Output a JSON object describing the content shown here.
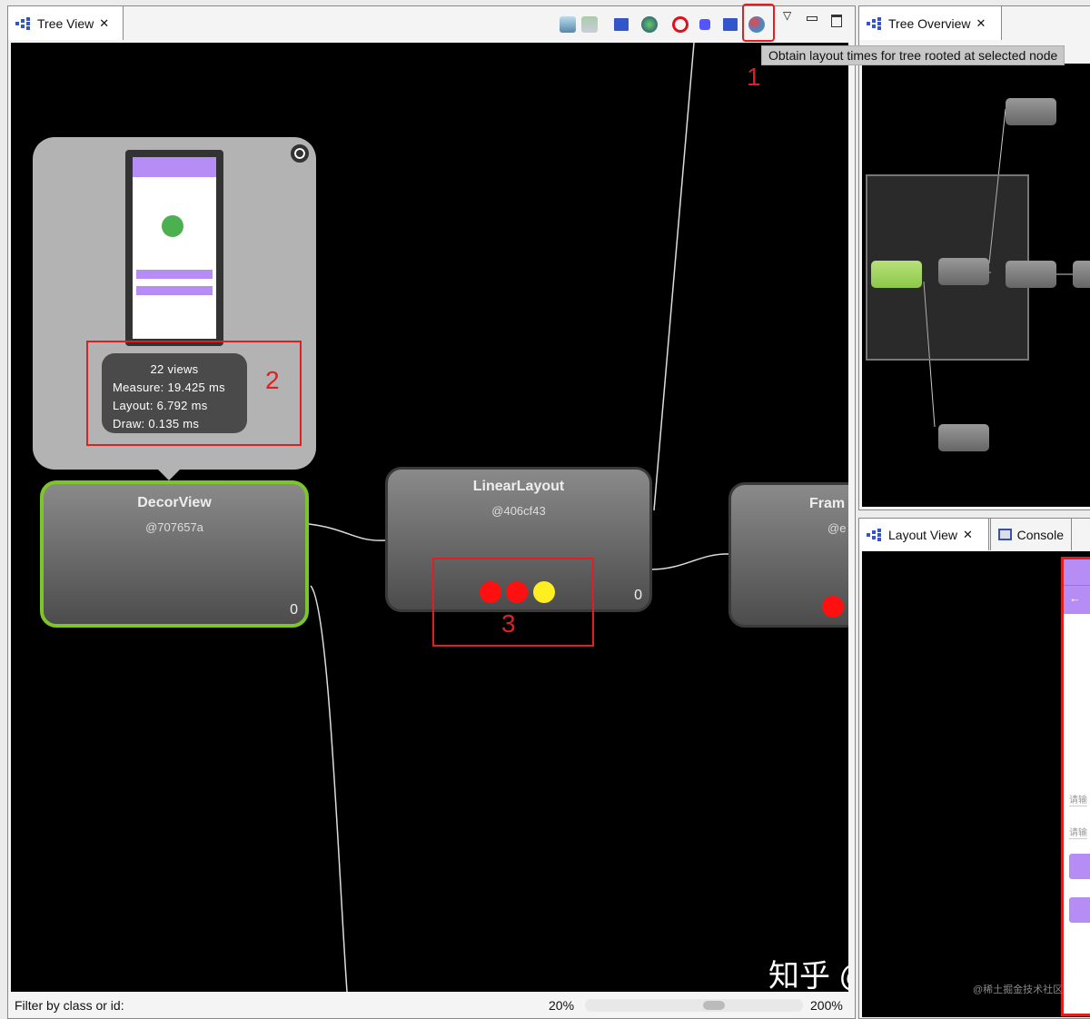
{
  "tree_view": {
    "tab_label": "Tree View",
    "toolbar_icons": [
      "save-icon",
      "capture-layers-icon",
      "tree-icon",
      "globe-icon",
      "stop-icon",
      "invalidate-icon",
      "request-layout-icon",
      "profile-nodes-icon",
      "view-menu-icon",
      "minimize-icon",
      "maximize-icon"
    ],
    "tooltip": "Obtain layout times for tree rooted at selected node",
    "annotations": [
      "1",
      "2",
      "3"
    ],
    "popup": {
      "views": "22 views",
      "measure": "Measure: 19.425 ms",
      "layout": "Layout: 6.792 ms",
      "draw": "Draw: 0.135 ms"
    },
    "nodes": [
      {
        "title": "DecorView",
        "id": "@707657a",
        "count": "0",
        "selected": true
      },
      {
        "title": "LinearLayout",
        "id": "@406cf43",
        "count": "0",
        "indicators": [
          "#ff1010",
          "#ff1010",
          "#ffee22"
        ]
      },
      {
        "title": "Fram",
        "id": "@e",
        "indicators": [
          "#ff1010"
        ]
      }
    ],
    "filter_label": "Filter by class or id:",
    "zoom_min": "20%",
    "zoom_max": "200%"
  },
  "tree_overview": {
    "tab_label": "Tree Overview"
  },
  "layout_view": {
    "tab_label": "Layout View",
    "console_label": "Console",
    "hint1": "请输",
    "hint2": "请输"
  },
  "watermark": {
    "main": "知乎 @Android小瓜",
    "sub": "@稀土掘金技术社区"
  },
  "colors": {
    "selected_border": "#7cc52a",
    "annotation": "#e02020",
    "accent_purple": "#b68cf5"
  }
}
